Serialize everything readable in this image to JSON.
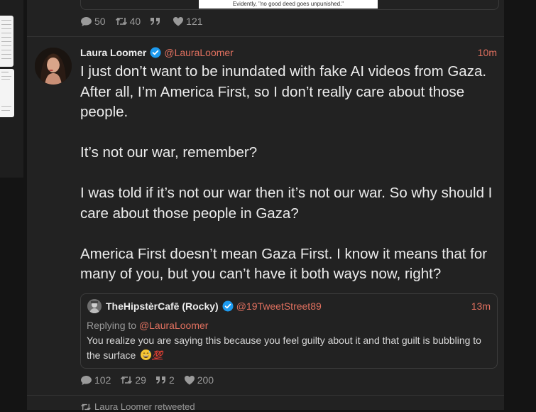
{
  "previous_tweet": {
    "image_caption": "Evidently, \"no good deed goes unpunished.\"",
    "stats": {
      "replies": "50",
      "retweets": "40",
      "quotes": "",
      "likes": "121"
    }
  },
  "tweet": {
    "author_name": "Laura Loomer",
    "handle": "@LauraLoomer",
    "time": "10m",
    "text": "I just don’t want to be inundated with fake AI videos from Gaza. After all, I’m America First, so I don’t really care about those people.\n\nIt’s not our war, remember?\n\nI was told if it’s not our war then it’s not our war. So why should I care about those people in Gaza?\n\nAmerica First doesn’t mean Gaza First. I know it means that for many of you, but you can’t have it both ways now, right?",
    "stats": {
      "replies": "102",
      "retweets": "29",
      "quotes": "2",
      "likes": "200"
    }
  },
  "quoted_tweet": {
    "author_name": "TheHipstèrCafē (Rocky)",
    "handle": "@19TweetStreet89",
    "time": "13m",
    "replying_label": "Replying to",
    "replying_handle": "@LauraLoomer",
    "text": "You realize you are saying this because you feel guilty about it and that guilt is bubbling to the surface"
  },
  "next_item": {
    "retweeted_label": "Laura Loomer retweeted"
  },
  "colors": {
    "accent": "#e0705f",
    "verified": "#1d9bf0",
    "background": "#222222"
  },
  "icons": [
    "reply-icon",
    "retweet-icon",
    "quote-icon",
    "heart-icon",
    "verified-badge-icon"
  ]
}
